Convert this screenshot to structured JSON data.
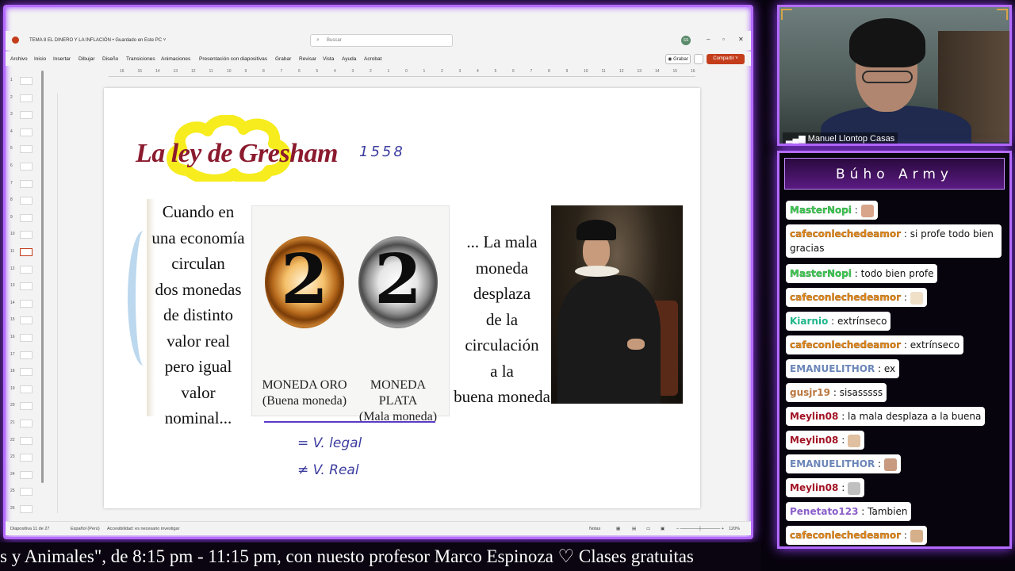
{
  "ppt": {
    "doc_title": "TEMA 8 EL DINERO Y LA INFLACIÓN • Guardado en Este PC ˅",
    "search_placeholder": "Buscar",
    "user_initials": "SS",
    "menu": [
      "Archivo",
      "Inicio",
      "Insertar",
      "Dibujar",
      "Diseño",
      "Transiciones",
      "Animaciones",
      "Presentación con diapositivas",
      "Grabar",
      "Revisar",
      "Vista",
      "Ayuda",
      "Acrobat"
    ],
    "grabar_button": "Grabar",
    "share_button": "Compartir",
    "ruler_ticks": [
      "16",
      "15",
      "14",
      "13",
      "12",
      "11",
      "10",
      "9",
      "8",
      "7",
      "6",
      "5",
      "4",
      "3",
      "2",
      "1",
      "0",
      "1",
      "2",
      "3",
      "4",
      "5",
      "6",
      "7",
      "8",
      "9",
      "10",
      "11",
      "12",
      "13",
      "14",
      "15",
      "16"
    ],
    "slide_numbers": [
      "1",
      "2",
      "3",
      "4",
      "5",
      "6",
      "7",
      "8",
      "9",
      "10",
      "11",
      "12",
      "13",
      "14",
      "15",
      "16",
      "17",
      "18",
      "19",
      "20",
      "21",
      "22",
      "23",
      "24",
      "25",
      "26"
    ],
    "active_slide": "11",
    "status": {
      "slide_count": "Diapositiva 11 de 27",
      "language": "Español (Perú)",
      "accessibility": "Accesibilidad: es necesario investigar",
      "notes": "Notas",
      "zoom": "120%"
    }
  },
  "slide": {
    "title": "La ley de Gresham",
    "ink_year": "1558",
    "left_text": [
      "Cuando en",
      "una economía",
      "circulan",
      "dos monedas",
      "de distinto",
      "valor real",
      "pero igual",
      "valor nominal..."
    ],
    "coin_gold_digit": "2",
    "coin_silver_digit": "2",
    "coin_gold_label": [
      "MONEDA ORO",
      "(Buena moneda)"
    ],
    "coin_silver_label": [
      "MONEDA PLATA",
      "(Mala moneda)"
    ],
    "right_text": [
      "... La mala",
      "moneda",
      "desplaza",
      "de la",
      "circulación",
      "a la",
      "buena moneda"
    ],
    "ink_note_1": "= V. legal",
    "ink_note_2": "≠ V. Real"
  },
  "ticker": "s y Animales\", de 8:15 pm - 11:15 pm, con nuesto profesor Marco Espinoza   ♡   Clases gratuitas",
  "cam": {
    "name": "Manuel Llontop Casas"
  },
  "chat": {
    "title": "Búho Army",
    "messages": [
      {
        "user": "MasterNopi",
        "text": "",
        "emote": true,
        "color": "u-green"
      },
      {
        "user": "cafeconlechedeamor",
        "text": "si profe todo bien gracias",
        "color": "u-orange"
      },
      {
        "user": "MasterNopi",
        "text": "todo bien profe",
        "color": "u-green"
      },
      {
        "user": "cafeconlechedeamor",
        "text": "",
        "emote": true,
        "color": "u-orange"
      },
      {
        "user": "Kiarnio",
        "text": "extrínseco",
        "color": "u-teal"
      },
      {
        "user": "cafeconlechedeamor",
        "text": "extrínseco",
        "color": "u-orange"
      },
      {
        "user": "EMANUELITHOR",
        "text": "ex",
        "color": "u-blue"
      },
      {
        "user": "gusjr19",
        "text": "sisasssss",
        "color": "u-tan"
      },
      {
        "user": "Meylin08",
        "text": "la mala desplaza a la buena",
        "color": "u-red"
      },
      {
        "user": "Meylin08",
        "text": "",
        "emote": true,
        "color": "u-red"
      },
      {
        "user": "EMANUELITHOR",
        "text": "",
        "emote": true,
        "color": "u-blue"
      },
      {
        "user": "Meylin08",
        "text": "",
        "emote": true,
        "color": "u-red"
      },
      {
        "user": "Penetato123",
        "text": "Tambien",
        "color": "u-purple"
      },
      {
        "user": "cafeconlechedeamor",
        "text": "",
        "emote": true,
        "color": "u-orange"
      }
    ]
  },
  "colors": {
    "frame_glow": "#b46bff",
    "title_red": "#8b1a2e",
    "ink_blue": "#3c3ca0",
    "share_red": "#c43e1c"
  }
}
